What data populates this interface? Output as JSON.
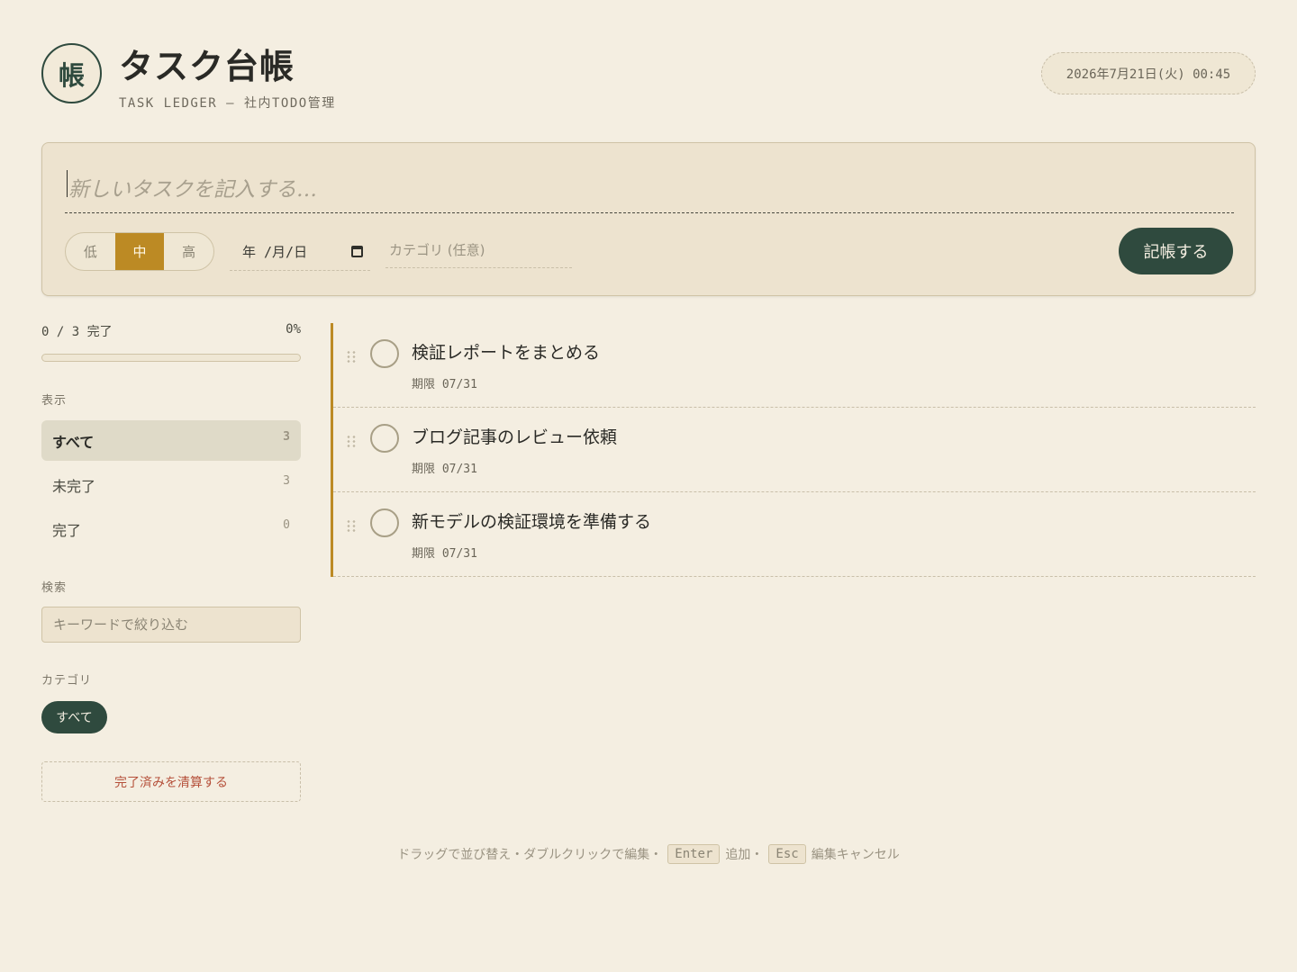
{
  "header": {
    "seal_char": "帳",
    "title": "タスク台帳",
    "subtitle": "TASK LEDGER — 社内TODO管理",
    "datetime": "2026年7月21日(火) 00:45"
  },
  "entry": {
    "task_placeholder": "新しいタスクを記入する…",
    "priority_options": [
      "低",
      "中",
      "高"
    ],
    "priority_selected": "中",
    "date_placeholder": "年 /月/日",
    "category_placeholder": "カテゴリ (任意)",
    "submit_label": "記帳する"
  },
  "sidebar": {
    "progress_text": "0 / 3 完了",
    "progress_percent_text": "0%",
    "progress_fraction": 0,
    "view_label": "表示",
    "filters": [
      {
        "label": "すべて",
        "count": "3",
        "active": true
      },
      {
        "label": "未完了",
        "count": "3",
        "active": false
      },
      {
        "label": "完了",
        "count": "0",
        "active": false
      }
    ],
    "search_label": "検索",
    "search_placeholder": "キーワードで絞り込む",
    "category_label": "カテゴリ",
    "category_chip": "すべて",
    "clear_label": "完了済みを清算する"
  },
  "tasks": [
    {
      "title": "検証レポートをまとめる",
      "due": "期限 07/31",
      "done": false
    },
    {
      "title": "ブログ記事のレビュー依頼",
      "due": "期限 07/31",
      "done": false
    },
    {
      "title": "新モデルの検証環境を準備する",
      "due": "期限 07/31",
      "done": false
    }
  ],
  "footer": {
    "hint_text": "ドラッグで並び替え・ダブルクリックで編集・",
    "key_enter": "Enter",
    "key_enter_action": "追加・",
    "key_esc": "Esc",
    "key_esc_action": "編集キャンセル"
  },
  "colors": {
    "accent": "#bc8a24",
    "primary": "#2f4a3e",
    "danger": "#b5503a",
    "background": "#f4eee1"
  }
}
